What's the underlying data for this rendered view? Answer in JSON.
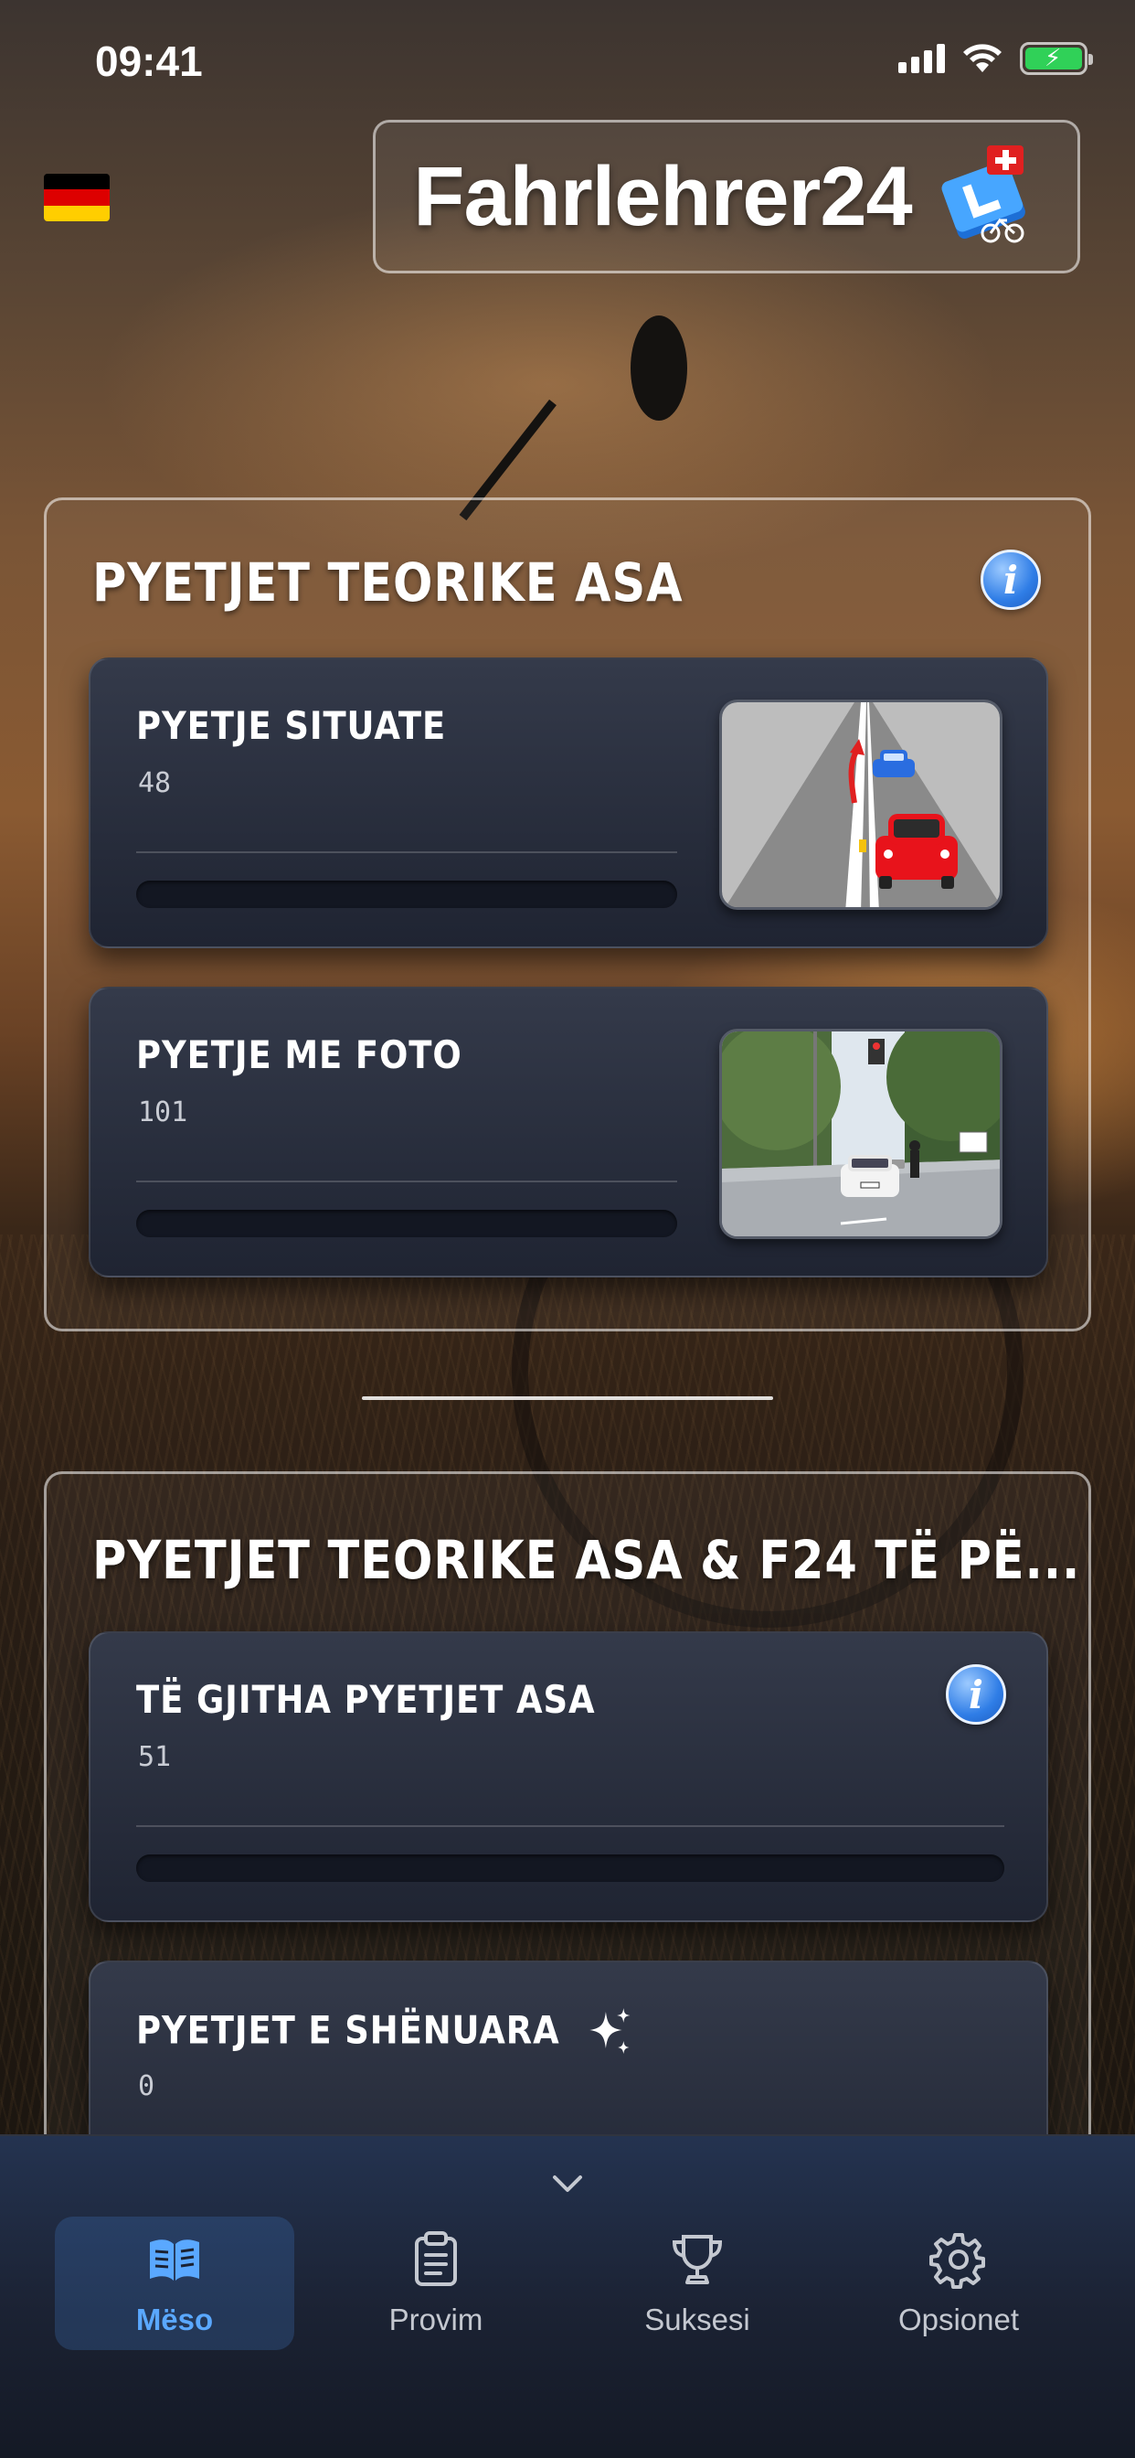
{
  "status_bar": {
    "time": "09:41"
  },
  "header": {
    "brand_name": "Fahrlehrer24",
    "language_flag": "german-flag-icon",
    "logo_icon": "driving-school-l-plate-icon"
  },
  "sections": [
    {
      "title": "PYETJET TEORIKE ASA",
      "has_info_icon": true,
      "cards": [
        {
          "title": "PYETJE SITUATE",
          "count": "48",
          "progress": 0,
          "thumbnail": "situation-illustration"
        },
        {
          "title": "PYETJE ME FOTO",
          "count": "101",
          "progress": 0,
          "thumbnail": "street-photo"
        }
      ]
    },
    {
      "title": "PYETJET TEORIKE ASA & F24 TË PË...",
      "cards": [
        {
          "title": "TË GJITHA PYETJET ASA",
          "count": "51",
          "progress": 0,
          "has_info_icon": true
        },
        {
          "title": "PYETJET E SHËNUARA",
          "count": "0",
          "icon": "sparkle-icon"
        }
      ]
    }
  ],
  "bottom_nav": {
    "tabs": [
      {
        "label": "Mëso",
        "icon": "book-icon",
        "active": true
      },
      {
        "label": "Provim",
        "icon": "clipboard-icon",
        "active": false
      },
      {
        "label": "Suksesi",
        "icon": "trophy-icon",
        "active": false
      },
      {
        "label": "Opsionet",
        "icon": "gear-icon",
        "active": false
      }
    ]
  },
  "colors": {
    "accent": "#5aa8ff",
    "card_bg": "#2a2f3d",
    "info_blue": "#2f7de6",
    "battery_green": "#30d158"
  }
}
